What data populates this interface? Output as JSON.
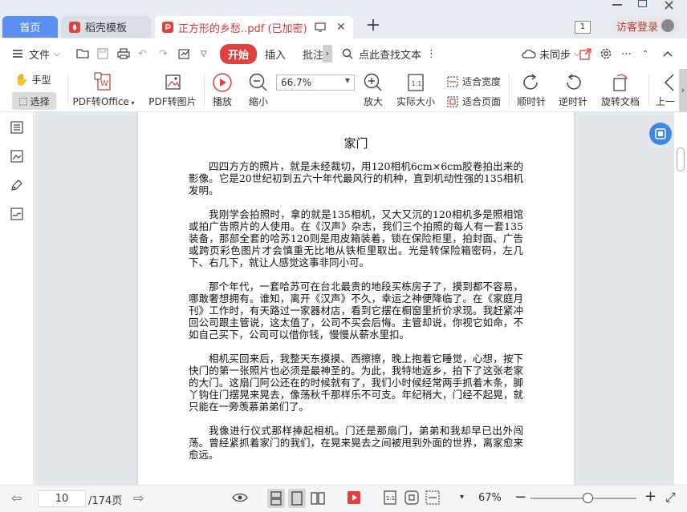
{
  "tabs": {
    "home": "首页",
    "templates": "稻壳模板",
    "document": "正方形的乡愁..pdf (已加密)"
  },
  "window": {
    "page_counter": "1",
    "visitor_label": "访客登录"
  },
  "menu": {
    "file": "文件",
    "start": "开始",
    "insert": "插入",
    "annotate": "批注",
    "search": "点此查找文本",
    "sync": "未同步"
  },
  "toolbar": {
    "hand": "手型",
    "select": "选择",
    "pdf_to_office": "PDF转Office",
    "pdf_to_image": "PDF转图片",
    "play": "播放",
    "zoom_out": "缩小",
    "zoom_value": "66.7%",
    "zoom_in": "放大",
    "actual_size": "实际大小",
    "fit_width": "适合宽度",
    "fit_page": "适合页面",
    "rotate_cw": "顺时针",
    "rotate_ccw": "逆时针",
    "rotate_doc": "旋转文档",
    "prev": "上一"
  },
  "document": {
    "title": "家门",
    "paragraphs": [
      "四四方方的照片，就是未经裁切，用120相机6cm×6cm胶卷拍出来的影像。它是20世纪初到五六十年代最风行的机种，直到机动性强的135相机发明。",
      "我刚学会拍照时，拿的就是135相机，又大又沉的120相机多是照相馆或拍广告照片的人使用。在《汉声》杂志，我们三个拍照的每人有一套135装备，那部全套的哈苏120则是用皮箱装着，锁在保险柜里，拍封面、广告或跨页彩色图片才会慎重无比地从铁柜里取出。光是转保险箱密码，左几下、右几下，就让人感觉这事非同小可。",
      "那个年代，一套哈苏可在台北最贵的地段买栋房子了，摸到都不容易，哪敢奢想拥有。谁知，离开《汉声》不久，幸运之神便降临了。在《家庭月刊》工作时，有天路过一家器材店，看到它摆在橱窗里折价求现。我赶紧冲回公司跟主管说，这太值了，公司不买会后悔。主管却说，你视它如命，不如自己买下，公司可以借你钱，慢慢从薪水里扣。",
      "相机买回来后，我整天东摸摸、西擦擦，晚上抱着它睡觉，心想，按下快门的第一张照片也必须是最神圣的。为此，我特地返乡，拍下了这张老家的大门。这扇门阿公还在的时候就有了，我们小时候经常两手抓着木条，脚丫钩住门摆晃来晃去，像荡秋千那样乐不可支。年纪稍大，门经不起晃，就只能在一旁羡慕弟弟们了。",
      "我像进行仪式那样捧起相机。门还是那扇门，弟弟和我却早已出外闯荡。曾经紧抓着家门的我们，在晃来晃去之间被甩到外面的世界，离家愈来愈远。"
    ]
  },
  "statusbar": {
    "current_page": "10",
    "total_pages": "/174页",
    "zoom": "67%"
  },
  "colors": {
    "accent_red": "#e0413c",
    "home_tab_blue": "#5b8ff0",
    "fab_blue": "#3f86e8"
  }
}
